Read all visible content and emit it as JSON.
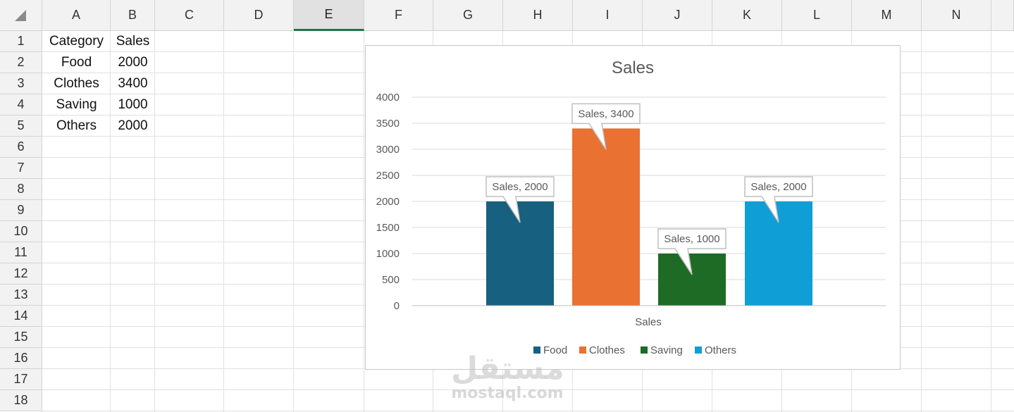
{
  "sheet": {
    "columns": [
      "A",
      "B",
      "C",
      "D",
      "E",
      "F",
      "G",
      "H",
      "I",
      "J",
      "K",
      "L",
      "M",
      "N"
    ],
    "selected_column": "E",
    "rows": [
      "1",
      "2",
      "3",
      "4",
      "5",
      "6",
      "7",
      "8",
      "9",
      "10",
      "11",
      "12",
      "13",
      "14",
      "15",
      "16",
      "17",
      "18"
    ],
    "table": {
      "headers": [
        "Category",
        "Sales"
      ],
      "rows": [
        [
          "Food",
          "2000"
        ],
        [
          "Clothes",
          "3400"
        ],
        [
          "Saving",
          "1000"
        ],
        [
          "Others",
          "2000"
        ]
      ]
    }
  },
  "chart_data": {
    "type": "bar",
    "title": "Sales",
    "xlabel": "Sales",
    "ylabel": "",
    "ylim": [
      0,
      4000
    ],
    "yticks": [
      "0",
      "500",
      "1000",
      "1500",
      "2000",
      "2500",
      "3000",
      "3500",
      "4000"
    ],
    "grid": true,
    "legend_position": "bottom",
    "series": [
      {
        "name": "Food",
        "value": 2000,
        "color": "#17607f",
        "label": "Sales, 2000"
      },
      {
        "name": "Clothes",
        "value": 3400,
        "color": "#e97132",
        "label": "Sales, 3400"
      },
      {
        "name": "Saving",
        "value": 1000,
        "color": "#1e6b25",
        "label": "Sales, 1000"
      },
      {
        "name": "Others",
        "value": 2000,
        "color": "#0f9ed5",
        "label": "Sales, 2000"
      }
    ]
  },
  "watermark": {
    "arabic": "مستقل",
    "latin": "mostaql.com"
  }
}
